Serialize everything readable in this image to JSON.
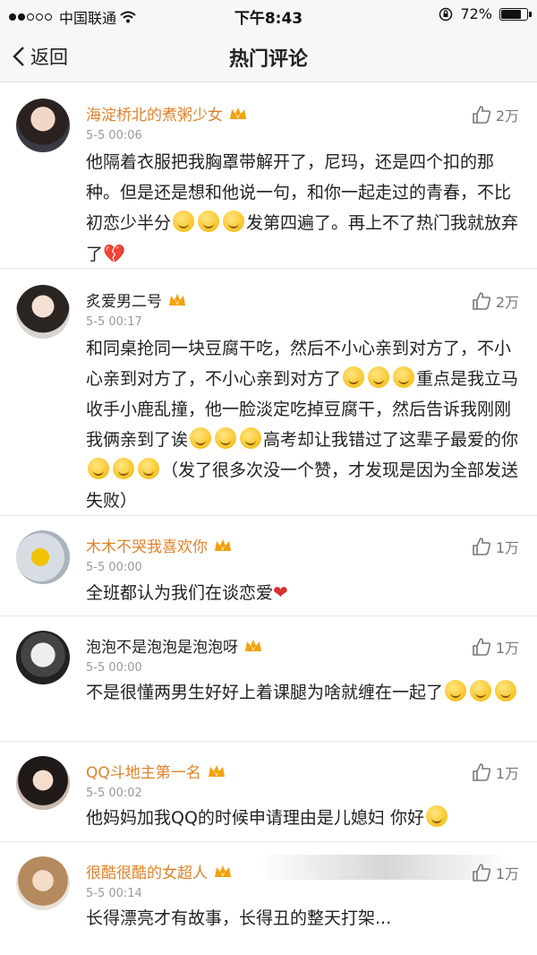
{
  "status": {
    "carrier": "中国联通",
    "time": "下午8:43",
    "battery": "72%"
  },
  "nav": {
    "back_label": "返回",
    "title": "热门评论"
  },
  "comments": [
    {
      "username": "海淀桥北的煮粥少女",
      "time": "5-5 00:06",
      "likes": "2万",
      "text_a": "他隔着衣服把我胸罩带解开了，尼玛，还是四个扣的那种。但是还是想和他说一句，和你一起走过的青春，不比初恋少半分",
      "text_b": "发第四遍了。再上不了热门我就放弃了"
    },
    {
      "username": "炙爱男二号",
      "time": "5-5 00:17",
      "likes": "2万",
      "text_a": "和同桌抢同一块豆腐干吃，然后不小心亲到对方了，不小心亲到对方了，不小心亲到对方了",
      "text_b": "重点是我立马收手小鹿乱撞，他一脸淡定吃掉豆腐干，然后告诉我刚刚我俩亲到了诶",
      "text_c": "高考却让我错过了这辈子最爱的你",
      "text_d": "（发了很多次没一个赞，才发现是因为全部发送失败）"
    },
    {
      "username": "木木不哭我喜欢你",
      "time": "5-5 00:00",
      "likes": "1万",
      "text_a": "全班都认为我们在谈恋爱"
    },
    {
      "username": "泡泡不是泡泡是泡泡呀",
      "time": "5-5 00:00",
      "likes": "1万",
      "text_a": "不是很懂两男生好好上着课腿为啥就缠在一起了"
    },
    {
      "username": "QQ斗地主第一名",
      "time": "5-5 00:02",
      "likes": "1万",
      "text_a": "他妈妈加我QQ的时候申请理由是儿媳妇 你好"
    },
    {
      "username": "很酷很酷的女超人",
      "time": "5-5 00:14",
      "likes": "1万",
      "text_a": "长得漂亮才有故事，长得丑的整天打架..."
    }
  ],
  "icons": {
    "like": "thumbs-up-icon",
    "vip": "vip-crown-icon",
    "back": "chevron-left-icon"
  },
  "colors": {
    "username": "#e0822a",
    "meta": "#999999",
    "heart": "#d93030"
  }
}
